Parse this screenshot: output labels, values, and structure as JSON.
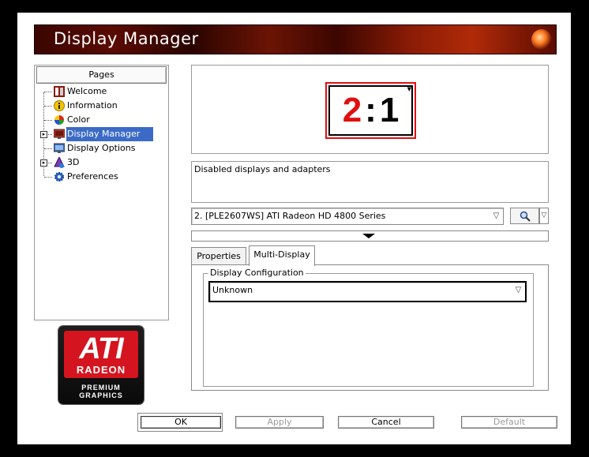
{
  "window": {
    "title": "Display Manager"
  },
  "pages": {
    "header": "Pages",
    "items": [
      {
        "label": "Welcome",
        "icon": "welcome-icon",
        "expandable": false,
        "selected": false
      },
      {
        "label": "Information",
        "icon": "information-icon",
        "expandable": false,
        "selected": false
      },
      {
        "label": "Color",
        "icon": "color-icon",
        "expandable": false,
        "selected": false
      },
      {
        "label": "Display Manager",
        "icon": "display-manager-icon",
        "expandable": true,
        "selected": true
      },
      {
        "label": "Display Options",
        "icon": "display-options-icon",
        "expandable": false,
        "selected": false
      },
      {
        "label": "3D",
        "icon": "3d-icon",
        "expandable": true,
        "selected": false
      },
      {
        "label": "Preferences",
        "icon": "preferences-icon",
        "expandable": false,
        "selected": false
      }
    ]
  },
  "logo": {
    "brand": "ATI",
    "line2": "RADEON",
    "line3": "PREMIUM",
    "line4": "GRAPHICS"
  },
  "preview": {
    "display_number": "2",
    "separator": ":",
    "adapter_number": "1",
    "accent_color": "#e01010"
  },
  "description": {
    "text": "Disabled displays and adapters"
  },
  "adapter_select": {
    "value": "2.  [PLE2607WS] ATI Radeon HD 4800 Series"
  },
  "tabs": [
    {
      "label": "Properties",
      "active": false
    },
    {
      "label": "Multi-Display",
      "active": true
    }
  ],
  "multi_display": {
    "group_label": "Display Configuration",
    "config_value": "Unknown"
  },
  "buttons": {
    "ok": "OK",
    "apply": "Apply",
    "cancel": "Cancel",
    "default": "Default"
  }
}
